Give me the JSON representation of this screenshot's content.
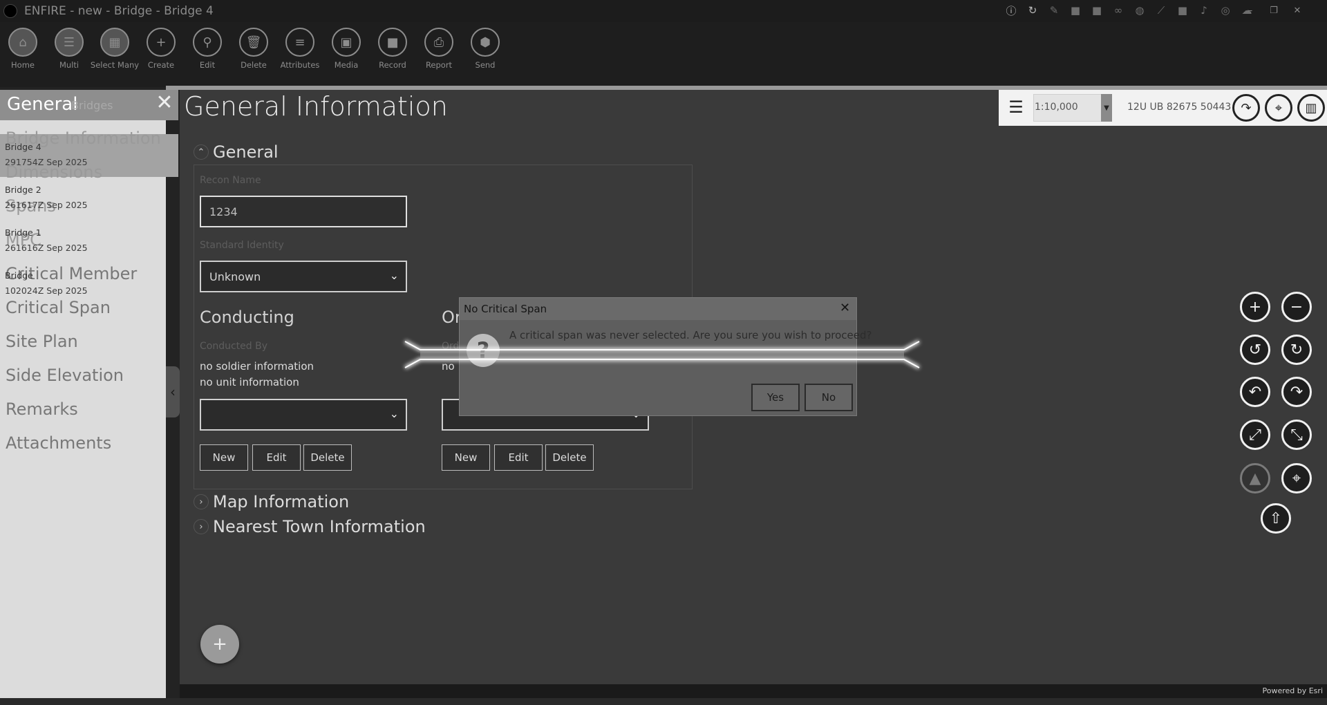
{
  "window": {
    "title": "ENFIRE - new - Bridge - Bridge 4",
    "controls": [
      "minimize-icon",
      "restore-icon",
      "close-icon"
    ]
  },
  "toolbar": {
    "items": [
      {
        "label": "Home",
        "icon": "home-icon"
      },
      {
        "label": "Multi",
        "icon": "multi-icon"
      },
      {
        "label": "Select Many",
        "icon": "select-many-icon"
      },
      {
        "label": "Create",
        "icon": "plus-icon"
      },
      {
        "label": "Edit",
        "icon": "pin-icon"
      },
      {
        "label": "Delete",
        "icon": "trash-icon"
      },
      {
        "label": "Attributes",
        "icon": "list-icon"
      },
      {
        "label": "Media",
        "icon": "image-icon"
      },
      {
        "label": "Record",
        "icon": "video-icon"
      },
      {
        "label": "Report",
        "icon": "printer-icon"
      },
      {
        "label": "Send",
        "icon": "send-icon"
      }
    ]
  },
  "left_panel": {
    "title": "General",
    "subtitle": "Bridges",
    "nav": [
      "Bridge Information",
      "Dimensions",
      "Spans",
      "MPC",
      "Critical Member",
      "Critical Span",
      "Site Plan",
      "Side Elevation",
      "Remarks",
      "Attachments"
    ],
    "bridges": [
      {
        "name": "Bridge 4",
        "date": "291754Z Sep 2025"
      },
      {
        "name": "Bridge 2",
        "date": "261617Z Sep 2025"
      },
      {
        "name": "Bridge 1",
        "date": "261616Z Sep 2025"
      },
      {
        "name": "Bridge",
        "date": "102024Z Sep 2025"
      }
    ]
  },
  "main": {
    "page_title": "General Information",
    "general_section": {
      "title": "General",
      "recon_name_label": "Recon Name",
      "recon_name_value": "1234",
      "standard_identity_label": "Standard Identity",
      "standard_identity_value": "Unknown"
    },
    "conducting": {
      "title": "Conducting",
      "label": "Conducted By",
      "info_soldier": "no soldier information",
      "info_unit": "no unit information",
      "buttons": {
        "new": "New",
        "edit": "Edit",
        "delete": "Delete"
      }
    },
    "ordering": {
      "title_partial": "Or",
      "label_partial": "Ord",
      "info_partial": "no",
      "buttons": {
        "new": "New",
        "edit": "Edit",
        "delete": "Delete"
      }
    },
    "map_info_title": "Map Information",
    "nearest_town_title": "Nearest Town Information",
    "add_button": "+"
  },
  "map": {
    "scale": "1:10,000",
    "coordinates": "12U UB 82675 50443",
    "powered_by": "Powered by Esri",
    "controls": [
      "zoom-in-icon",
      "zoom-out-icon",
      "rotate-left-icon",
      "rotate-right-icon",
      "undo-icon",
      "redo-icon",
      "expand-icon",
      "collapse-icon",
      "navigate-icon",
      "locate-icon",
      "north-arrow-icon"
    ]
  },
  "dialog": {
    "title": "No Critical Span",
    "message": "A critical span was never selected. Are you sure you wish to proceed?",
    "yes": "Yes",
    "no": "No",
    "icon": "question-icon"
  },
  "colors": {
    "background": "#232323",
    "panel": "#3a3a3a",
    "left_panel": "#dcdcdc",
    "dialog": "#5e5e5e"
  }
}
